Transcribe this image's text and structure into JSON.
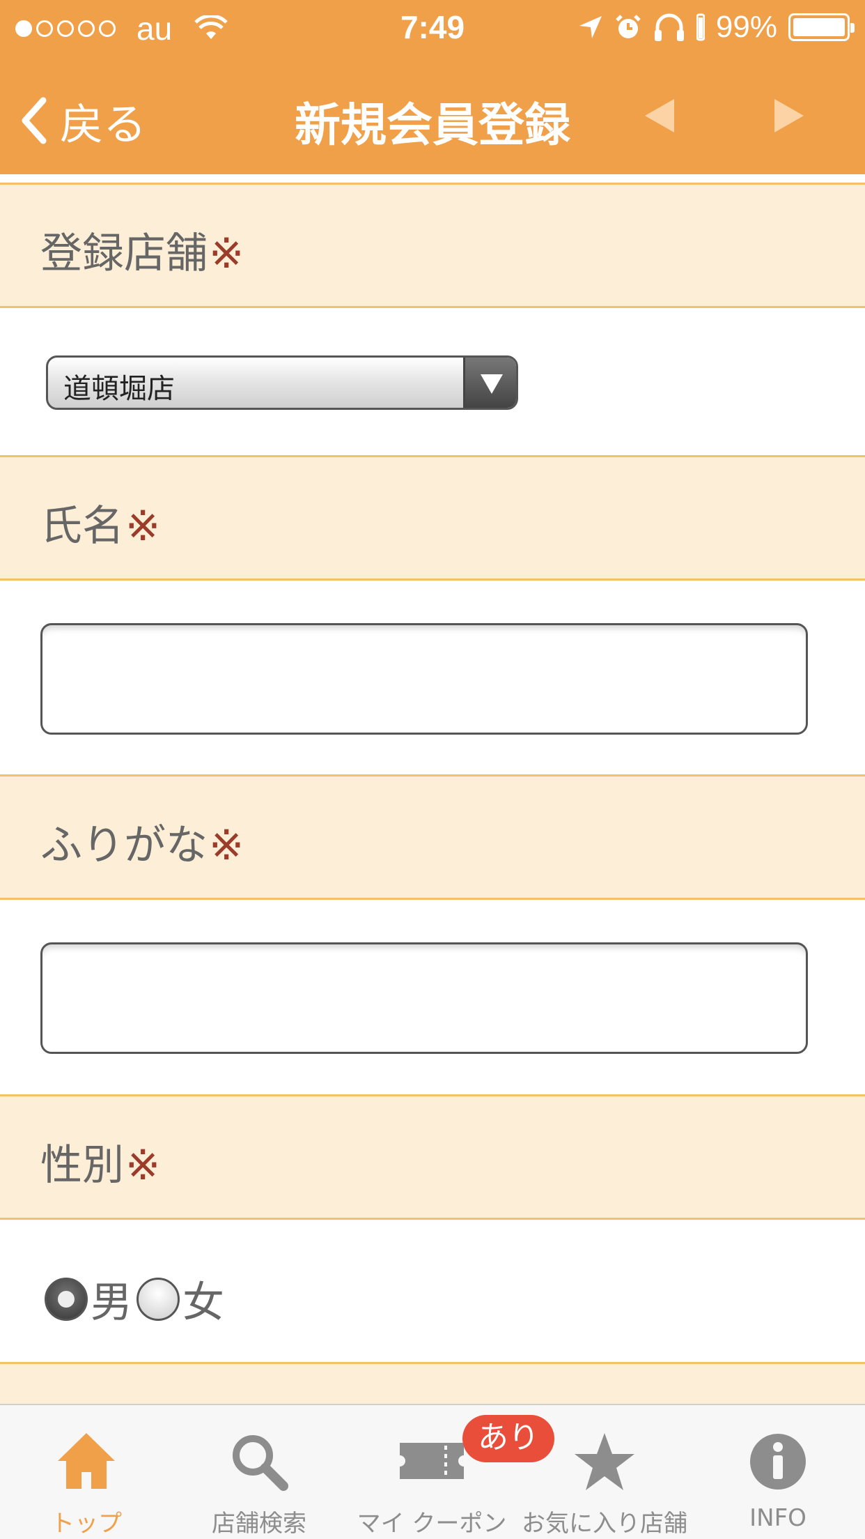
{
  "status_bar": {
    "carrier": "au",
    "time": "7:49",
    "battery": "99%"
  },
  "nav": {
    "back_label": "戻る",
    "title": "新規会員登録"
  },
  "form": {
    "store": {
      "label": "登録店舗",
      "required_mark": "※",
      "selected_value": "道頓堀店"
    },
    "name": {
      "label": "氏名",
      "required_mark": "※",
      "value": ""
    },
    "furigana": {
      "label": "ふりがな",
      "required_mark": "※",
      "value": ""
    },
    "gender": {
      "label": "性別",
      "required_mark": "※",
      "options": [
        "男",
        "女"
      ],
      "selected": "男"
    }
  },
  "tabs": [
    {
      "label": "トップ",
      "icon": "home-icon",
      "active": true
    },
    {
      "label": "店舗検索",
      "icon": "search-icon",
      "active": false
    },
    {
      "label": "マイ クーポン",
      "icon": "ticket-icon",
      "active": false,
      "badge": "あり"
    },
    {
      "label": "お気に入り店舗",
      "icon": "star-icon",
      "active": false
    },
    {
      "label": "INFO",
      "icon": "info-icon",
      "active": false
    }
  ],
  "colors": {
    "brand_orange": "#f0a049",
    "section_bg": "#fdefd7",
    "required_mark": "#9b3b2a",
    "badge": "#e94e3b"
  }
}
